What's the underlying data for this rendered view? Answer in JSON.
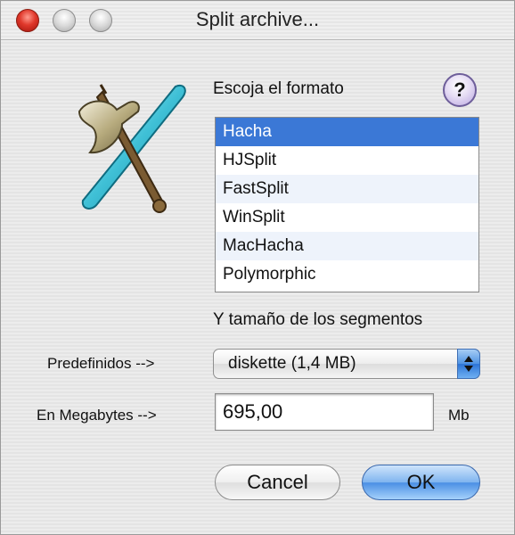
{
  "window": {
    "title": "Split archive..."
  },
  "format": {
    "label": "Escoja el formato",
    "help_symbol": "?",
    "options": [
      "Hacha",
      "HJSplit",
      "FastSplit",
      "WinSplit",
      "MacHacha",
      "Polymorphic"
    ],
    "selected": "Hacha"
  },
  "segments": {
    "heading": "Y tamaño de los segmentos",
    "predef_label": "Predefinidos -->",
    "predef_value": "diskette (1,4 MB)",
    "mb_label": "En Megabytes -->",
    "mb_value": "695,00",
    "unit": "Mb"
  },
  "buttons": {
    "cancel": "Cancel",
    "ok": "OK"
  },
  "colors": {
    "selection": "#3b78d6",
    "default_button": "#4a8fe4",
    "close_button": "#e0382b"
  },
  "icons": {
    "logo": "axe-cross-logo",
    "help": "help-icon",
    "popup": "up-down-arrows-icon"
  }
}
